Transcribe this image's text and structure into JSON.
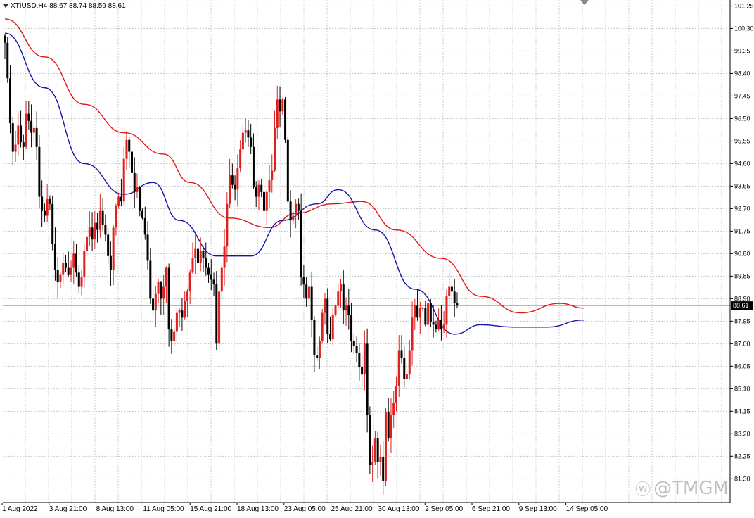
{
  "header": {
    "symbol": "XTIUSD,H4",
    "ohlc": "88.67 88.74 88.59 88.61"
  },
  "watermark": {
    "icon": "weibo-logo",
    "text": "@TMGM"
  },
  "colors": {
    "grid": "#c8c8c8",
    "axis": "#000000",
    "bull_candle": "#e0201e",
    "bear_candle": "#000000",
    "ma_fast": "#1414a8",
    "ma_slow": "#e41414",
    "price_line": "#8c8c8c",
    "price_tag_bg": "#000000",
    "price_tag_text": "#ffffff"
  },
  "chart_data": {
    "type": "candlestick",
    "ylim": [
      80.3,
      101.5
    ],
    "grid": true,
    "y_ticks": [
      "101.25",
      "100.30",
      "99.35",
      "98.40",
      "97.45",
      "96.50",
      "95.55",
      "94.60",
      "93.65",
      "92.70",
      "91.75",
      "90.80",
      "89.85",
      "88.90",
      "87.95",
      "87.00",
      "86.05",
      "85.10",
      "84.15",
      "83.20",
      "82.25",
      "81.30"
    ],
    "x_ticks": [
      "1 Aug 2022",
      "3 Aug 21:00",
      "8 Aug 13:00",
      "11 Aug 05:00",
      "15 Aug 21:00",
      "18 Aug 13:00",
      "23 Aug 05:00",
      "25 Aug 21:00",
      "30 Aug 13:00",
      "2 Sep 05:00",
      "6 Sep 21:00",
      "9 Sep 13:00",
      "14 Sep 05:00"
    ],
    "current_price": "88.61",
    "close": [
      99.7,
      98.2,
      96.3,
      95.1,
      95.4,
      96.2,
      95.5,
      95.3,
      96.7,
      96.4,
      95.9,
      96.1,
      95.3,
      93.2,
      92.6,
      92.4,
      93.1,
      92.9,
      91.2,
      90.1,
      89.6,
      89.9,
      90.4,
      90.2,
      89.9,
      90.2,
      90.8,
      90.0,
      89.4,
      89.8,
      90.9,
      91.5,
      91.9,
      91.4,
      92.1,
      91.8,
      92.6,
      92.0,
      91.6,
      90.7,
      90.1,
      91.9,
      92.8,
      93.2,
      93.0,
      94.8,
      95.6,
      95.1,
      94.2,
      93.4,
      93.6,
      92.6,
      92.3,
      91.6,
      90.5,
      88.9,
      88.4,
      89.1,
      89.6,
      88.9,
      89.4,
      90.2,
      87.6,
      87.1,
      87.5,
      88.3,
      88.4,
      88.1,
      88.8,
      89.2,
      90.0,
      90.6,
      91.0,
      90.4,
      90.9,
      90.6,
      90.2,
      89.9,
      89.7,
      89.5,
      87.0,
      89.2,
      90.2,
      91.1,
      92.9,
      94.1,
      93.7,
      93.5,
      94.4,
      95.2,
      95.9,
      96.0,
      95.7,
      95.3,
      93.6,
      93.2,
      93.7,
      93.4,
      92.6,
      93.4,
      93.9,
      94.3,
      96.1,
      97.3,
      96.8,
      97.3,
      95.6,
      93.0,
      92.2,
      92.4,
      92.9,
      92.6,
      89.8,
      89.5,
      88.9,
      89.4,
      88.0,
      86.5,
      86.4,
      87.1,
      88.3,
      88.9,
      87.4,
      87.2,
      88.2,
      88.6,
      89.2,
      89.5,
      88.4,
      88.6,
      88.2,
      87.1,
      86.9,
      86.6,
      86.0,
      85.7,
      87.0,
      84.0,
      81.9,
      82.0,
      83.0,
      82.0,
      82.2,
      81.2,
      84.1,
      83.0,
      84.0,
      84.5,
      85.2,
      86.7,
      86.4,
      85.5,
      85.7,
      86.7,
      88.1,
      88.6,
      88.1,
      88.5,
      88.5,
      87.8,
      88.7,
      87.9,
      87.8,
      87.6,
      88.0,
      87.6,
      87.8,
      89.0,
      89.4,
      89.2,
      88.7,
      88.61
    ],
    "ma_fast_anchors": [
      [
        0,
        100.1
      ],
      [
        15,
        97.8
      ],
      [
        30,
        94.6
      ],
      [
        45,
        93.3
      ],
      [
        56,
        93.8
      ],
      [
        66,
        92.2
      ],
      [
        80,
        90.7
      ],
      [
        93,
        90.7
      ],
      [
        105,
        92.2
      ],
      [
        118,
        92.9
      ],
      [
        126,
        93.5
      ],
      [
        140,
        91.8
      ],
      [
        155,
        89.3
      ],
      [
        170,
        87.4
      ],
      [
        180,
        87.8
      ],
      [
        192,
        87.7
      ],
      [
        205,
        87.7
      ],
      [
        219,
        88.0
      ]
    ],
    "ma_slow_anchors": [
      [
        0,
        100.7
      ],
      [
        15,
        99.1
      ],
      [
        30,
        97.1
      ],
      [
        45,
        95.9
      ],
      [
        60,
        95.0
      ],
      [
        70,
        93.8
      ],
      [
        85,
        92.3
      ],
      [
        100,
        91.9
      ],
      [
        110,
        92.5
      ],
      [
        124,
        92.9
      ],
      [
        135,
        93.0
      ],
      [
        148,
        91.8
      ],
      [
        165,
        90.6
      ],
      [
        180,
        89.0
      ],
      [
        195,
        88.3
      ],
      [
        210,
        88.7
      ],
      [
        219,
        88.5
      ]
    ]
  }
}
